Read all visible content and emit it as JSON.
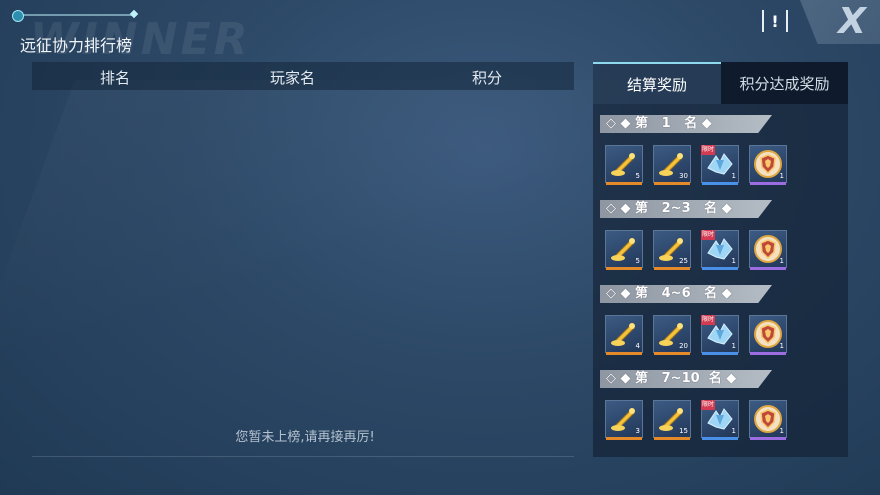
{
  "header": {
    "title": "远征协力排行榜",
    "watermark": "WINNER",
    "info_label": "!",
    "close_label": "X"
  },
  "ranking": {
    "columns": [
      "排名",
      "玩家名",
      "积分"
    ],
    "empty_message": "您暂未上榜,请再接再厉!"
  },
  "rewards": {
    "tabs": [
      {
        "label": "结算奖励",
        "active": true
      },
      {
        "label": "积分达成奖励",
        "active": false
      }
    ],
    "tiers": [
      {
        "label": "◇ ◆ 第   1   名 ◆",
        "counts": [
          "5",
          "30",
          "1",
          "1"
        ]
      },
      {
        "label": "◇ ◆ 第   2~3   名 ◆",
        "counts": [
          "5",
          "25",
          "1",
          "1"
        ]
      },
      {
        "label": "◇ ◆ 第   4~6   名 ◆",
        "counts": [
          "4",
          "20",
          "1",
          "1"
        ]
      },
      {
        "label": "◇ ◆ 第   7~10  名 ◆",
        "counts": [
          "3",
          "15",
          "1",
          "1"
        ]
      }
    ],
    "item_icons": [
      "trumpet-icon",
      "trumpet-icon",
      "crystal-wings-icon",
      "shield-emblem-icon"
    ],
    "item_bar_colors": [
      "#e58a2a",
      "#e58a2a",
      "#4a8fe8",
      "#9b6de0"
    ],
    "limited_tag": "限时"
  }
}
